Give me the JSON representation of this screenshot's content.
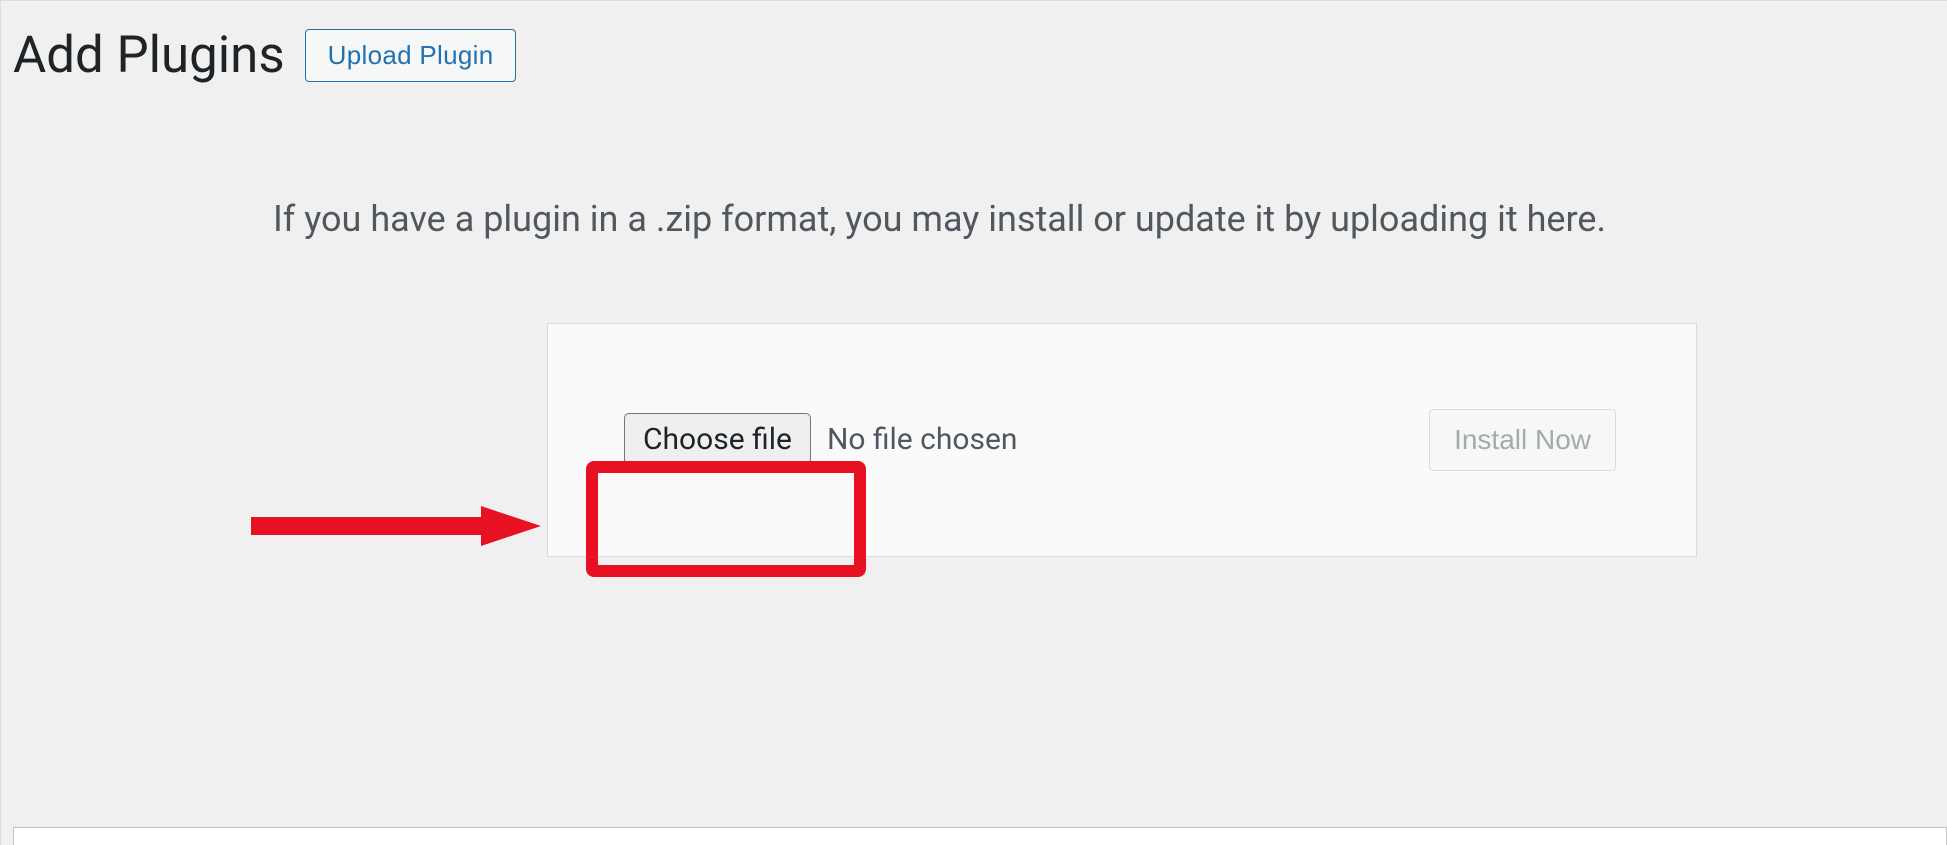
{
  "header": {
    "title": "Add Plugins",
    "upload_button": "Upload Plugin"
  },
  "instruction": "If you have a plugin in a .zip format, you may install or update it by uploading it here.",
  "upload_form": {
    "choose_file_label": "Choose file",
    "file_status": "No file chosen",
    "install_button": "Install Now"
  },
  "annotation": {
    "highlight_color": "#e81123",
    "arrow_color": "#e81123"
  }
}
